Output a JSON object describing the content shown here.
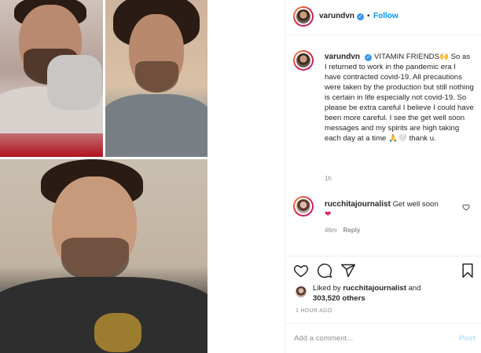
{
  "header": {
    "username": "varundvn",
    "dot": "•",
    "follow_label": "Follow"
  },
  "caption": {
    "username": "varundvn",
    "headline": "VITAMIN FRIENDS🙌",
    "body": "So as I returned to work in the pandemic era I have contracted covid-19. All precautions were taken by the production but still nothing is certain in life especially not covid-19. So please be extra careful I believe I could have been more careful. I see the get well soon messages and my spirits are high taking each day at a time 🙏🤍 thank u.",
    "time": "1h"
  },
  "comments": [
    {
      "username": "rucchitajournalist",
      "text": "Get well soon",
      "emoji": "❤",
      "time": "46m",
      "reply_label": "Reply"
    }
  ],
  "likes": {
    "prefix": "Liked by",
    "user": "rucchitajournalist",
    "conjunction": "and",
    "count": "303,520 others"
  },
  "timestamp": "1 HOUR AGO",
  "add_comment": {
    "placeholder": "Add a comment...",
    "post_label": "Post"
  },
  "colors": {
    "accent": "#0095f6",
    "verified": "#3897f0",
    "muted": "#8e8e8e"
  },
  "icons": [
    "verified-icon",
    "heart-icon",
    "comment-icon",
    "share-icon",
    "bookmark-icon"
  ]
}
